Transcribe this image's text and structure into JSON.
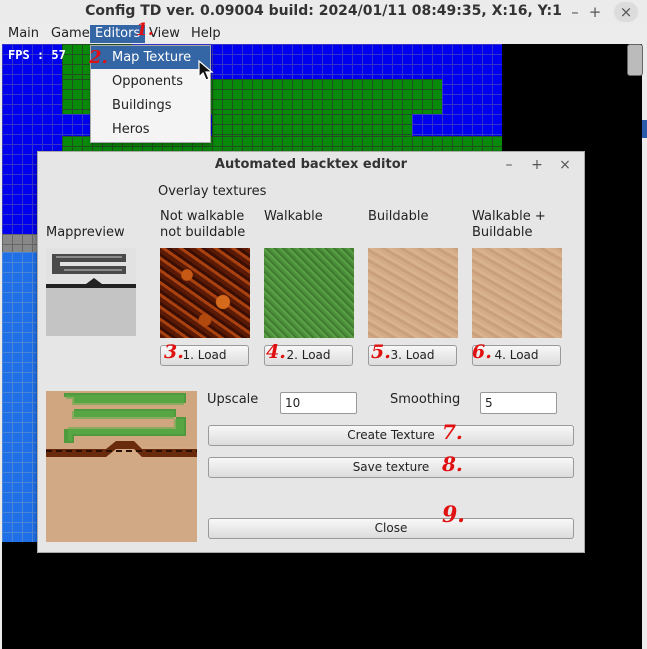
{
  "window": {
    "title": "Config TD ver. 0.09004 build: 2024/01/11  08:49:35, X:16, Y:1",
    "controls": {
      "minimize": "–",
      "maximize": "+",
      "close": "×"
    }
  },
  "menubar": {
    "items": [
      "Main",
      "Game",
      "Editors",
      "View",
      "Help"
    ]
  },
  "game": {
    "fps": "FPS : 57"
  },
  "dropdown": {
    "items": [
      "Map Texture",
      "Opponents",
      "Buildings",
      "Heros"
    ]
  },
  "annotations": [
    "1.",
    "2.",
    "3.",
    "4.",
    "5.",
    "6.",
    "7.",
    "8.",
    "9."
  ],
  "dialog": {
    "title": "Automated backtex editor",
    "controls": {
      "minimize": "–",
      "maximize": "+",
      "close": "×"
    },
    "overlay_header": "Overlay textures",
    "mappreview_label": "Mappreview",
    "columns": [
      {
        "label_line1": "Not walkable",
        "label_line2": "not buildable",
        "button": "1. Load"
      },
      {
        "label_line1": "Walkable",
        "label_line2": "",
        "button": "2. Load"
      },
      {
        "label_line1": "Buildable",
        "label_line2": "",
        "button": "3. Load"
      },
      {
        "label_line1": "Walkable +",
        "label_line2": "Buildable",
        "button": "4. Load"
      }
    ],
    "upscale_label": "Upscale",
    "upscale_value": "10",
    "smoothing_label": "Smoothing",
    "smoothing_value": "5",
    "create_button": "Create Texture",
    "save_button": "Save texture",
    "close_button": "Close"
  },
  "colors": {
    "accent": "#3465a4",
    "annotation": "#e01010"
  }
}
